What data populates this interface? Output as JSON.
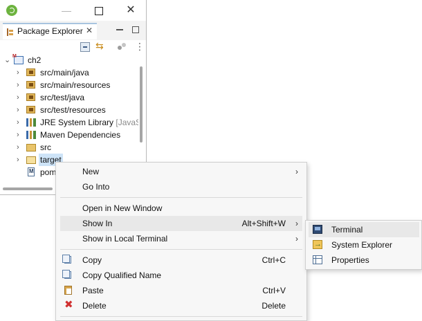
{
  "window": {
    "minimize_glyph": "—",
    "close_glyph": "✕"
  },
  "view": {
    "tab_label": "Package Explorer",
    "tab_close_glyph": "✕"
  },
  "tree": {
    "project": "ch2",
    "items": [
      {
        "label": "src/main/java",
        "icon": "package-folder-icon"
      },
      {
        "label": "src/main/resources",
        "icon": "package-folder-icon"
      },
      {
        "label": "src/test/java",
        "icon": "package-folder-icon"
      },
      {
        "label": "src/test/resources",
        "icon": "package-folder-icon"
      },
      {
        "label": "JRE System Library",
        "decoration": "[JavaS",
        "icon": "library-icon"
      },
      {
        "label": "Maven Dependencies",
        "icon": "library-icon"
      },
      {
        "label": "src",
        "icon": "folder-icon"
      },
      {
        "label": "target",
        "icon": "open-folder-icon"
      },
      {
        "label": "pom",
        "icon": "maven-file-icon"
      }
    ]
  },
  "context_menu": {
    "new": {
      "label": "New",
      "arrow": "›"
    },
    "go_into": {
      "label": "Go Into"
    },
    "open_new_window": {
      "label": "Open in New Window"
    },
    "show_in": {
      "label": "Show In",
      "shortcut": "Alt+Shift+W",
      "arrow": "›"
    },
    "show_in_local_terminal": {
      "label": "Show in Local Terminal",
      "arrow": "›"
    },
    "copy": {
      "label": "Copy",
      "shortcut": "Ctrl+C"
    },
    "copy_qualified_name": {
      "label": "Copy Qualified Name"
    },
    "paste": {
      "label": "Paste",
      "shortcut": "Ctrl+V"
    },
    "delete": {
      "label": "Delete",
      "shortcut": "Delete",
      "glyph": "✖"
    }
  },
  "submenu": {
    "terminal": "Terminal",
    "system_explorer": "System Explorer",
    "properties": "Properties"
  }
}
